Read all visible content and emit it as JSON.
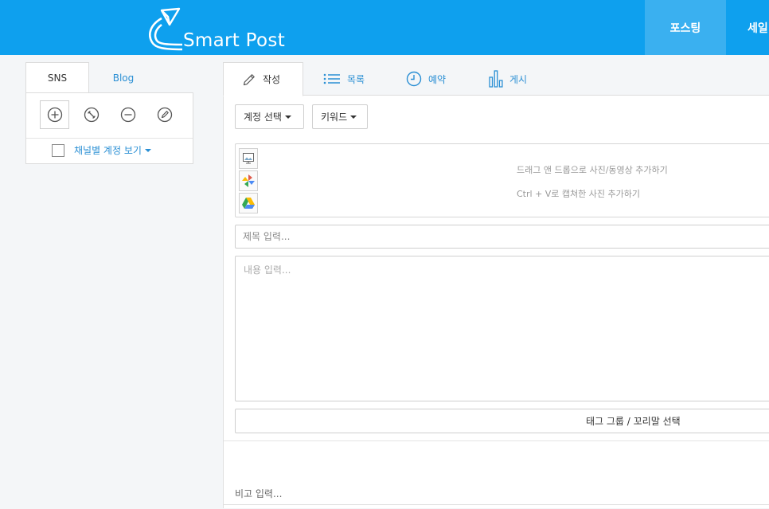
{
  "header": {
    "brand": "Smart Post",
    "logo_icon": "paper-plane-icon",
    "nav": [
      {
        "label": "포스팅",
        "active": true
      },
      {
        "label": "세일"
      }
    ],
    "colors": {
      "bar": "#0ea0ee",
      "active_nav": "#3ab0f0"
    }
  },
  "sidebar": {
    "tabs": [
      {
        "label": "SNS",
        "active": true
      },
      {
        "label": "Blog"
      }
    ],
    "tools": [
      {
        "icon": "plus-circle-icon",
        "active": true
      },
      {
        "icon": "wrench-icon"
      },
      {
        "icon": "minus-circle-icon"
      },
      {
        "icon": "pencil-circle-icon"
      }
    ],
    "channel_view": {
      "label": "채널별 계정 보기",
      "checked": false
    }
  },
  "main": {
    "tabs": [
      {
        "label": "작성",
        "icon": "pencil-icon",
        "active": true
      },
      {
        "label": "목록",
        "icon": "list-icon"
      },
      {
        "label": "예약",
        "icon": "clock-icon"
      },
      {
        "label": "게시",
        "icon": "bar-chart-icon"
      }
    ],
    "account_select": "계정 선택",
    "keyword_select": "키워드",
    "media": {
      "icons": [
        "image-upload-icon",
        "pinwheel-icon",
        "google-drive-icon"
      ],
      "drop_hint": "드래그 앤 드롭으로 사진/동영상 추가하기",
      "paste_hint": "Ctrl + V로 캡쳐한 사진 추가하기"
    },
    "title_placeholder": "제목 입력...",
    "content_placeholder": "내용 입력...",
    "tag_button": "태그 그룹 / 꼬리말 선택",
    "memo_placeholder": "비고 입력..."
  }
}
